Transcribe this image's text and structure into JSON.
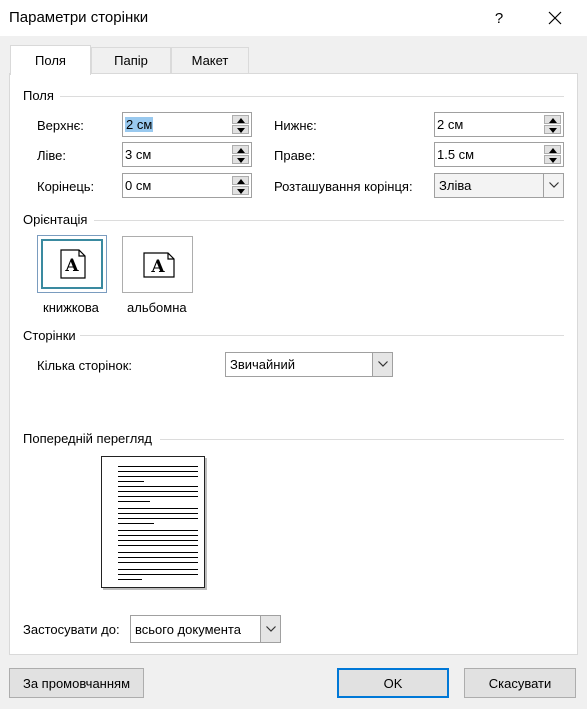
{
  "window": {
    "title": "Параметри сторінки",
    "help_label": "?"
  },
  "tabs": [
    {
      "label": "Поля",
      "active": true
    },
    {
      "label": "Папір",
      "active": false
    },
    {
      "label": "Макет",
      "active": false
    }
  ],
  "margins": {
    "section_label": "Поля",
    "top_label": "Верхнє:",
    "top_value": "2 см",
    "bottom_label": "Нижнє:",
    "bottom_value": "2 см",
    "left_label": "Ліве:",
    "left_value": "3 см",
    "right_label": "Праве:",
    "right_value": "1.5 см",
    "gutter_label": "Корінець:",
    "gutter_value": "0 см",
    "gutter_pos_label": "Розташування корінця:",
    "gutter_pos_value": "Зліва"
  },
  "orientation": {
    "section_label": "Орієнтація",
    "portrait_label": "книжкова",
    "landscape_label": "альбомна",
    "selected": "portrait",
    "icon_glyph": "A"
  },
  "pages": {
    "section_label": "Сторінки",
    "multiple_label": "Кілька сторінок:",
    "multiple_value": "Звичайний"
  },
  "preview": {
    "section_label": "Попередній перегляд"
  },
  "apply": {
    "label": "Застосувати до:",
    "value": "всього документа"
  },
  "buttons": {
    "default_label": "За промовчанням",
    "ok_label": "OK",
    "cancel_label": "Скасувати"
  },
  "colors": {
    "selection": "#99c9ef",
    "default_button_border": "#0078d7",
    "orientation_selected_border": "#3a8aa0"
  }
}
